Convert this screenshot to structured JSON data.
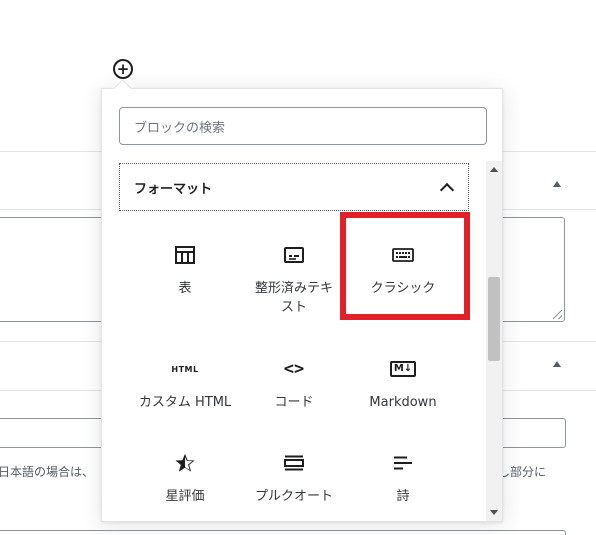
{
  "inserter": {
    "search_placeholder": "ブロックの検索",
    "panel": {
      "title": "フォーマット",
      "expanded": true
    },
    "blocks": [
      {
        "label": "表",
        "icon": "table-icon"
      },
      {
        "label": "整形済みテキスト",
        "icon": "preformatted-icon"
      },
      {
        "label": "クラシック",
        "icon": "keyboard-icon",
        "highlighted": true
      },
      {
        "label": "カスタム HTML",
        "icon": "html-icon",
        "icon_text": "HTML"
      },
      {
        "label": "コード",
        "icon": "code-icon",
        "icon_text": "<>"
      },
      {
        "label": "Markdown",
        "icon": "markdown-icon",
        "icon_text": "M↓"
      },
      {
        "label": "星評価",
        "icon": "star-icon"
      },
      {
        "label": "プルクオート",
        "icon": "pullquote-icon"
      },
      {
        "label": "詩",
        "icon": "verse-icon"
      }
    ]
  },
  "background": {
    "hint_left": "日本語の場合は、",
    "hint_right": "し部分に"
  },
  "colors": {
    "highlight": "#e3202a",
    "text": "#1e1e1e",
    "border": "#8d96a0"
  }
}
